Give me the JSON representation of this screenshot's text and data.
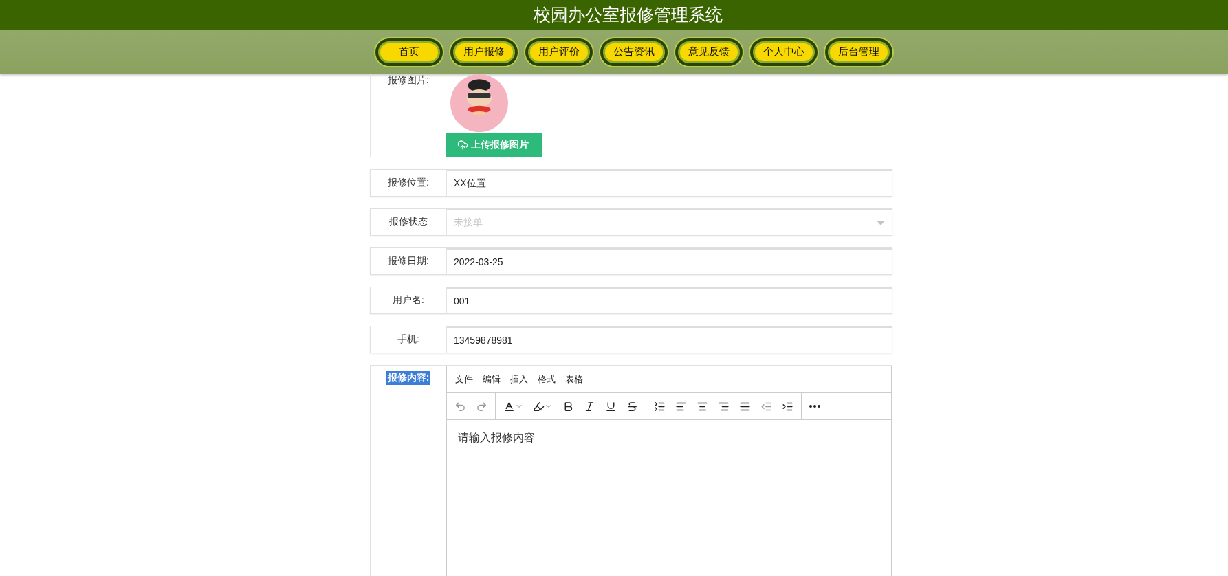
{
  "header": {
    "title": "校园办公室报修管理系统"
  },
  "nav": [
    {
      "label": "首页"
    },
    {
      "label": "用户报修"
    },
    {
      "label": "用户评价"
    },
    {
      "label": "公告资讯"
    },
    {
      "label": "意见反馈"
    },
    {
      "label": "个人中心"
    },
    {
      "label": "后台管理"
    }
  ],
  "image_field": {
    "label": "报修图片:",
    "upload_button": "上传报修图片"
  },
  "fields": [
    {
      "kind": "text",
      "label": "报修位置:",
      "value": "XX位置",
      "disabled": false
    },
    {
      "kind": "select",
      "label": "报修状态",
      "value": "未接单",
      "disabled": true
    },
    {
      "kind": "text",
      "label": "报修日期:",
      "value": "2022-03-25",
      "disabled": false
    },
    {
      "kind": "text",
      "label": "用户名:",
      "value": "001",
      "disabled": false
    },
    {
      "kind": "text",
      "label": "手机:",
      "value": "13459878981",
      "disabled": false
    }
  ],
  "editor": {
    "label": "报修内容:",
    "label_highlighted": true,
    "menu": [
      "文件",
      "编辑",
      "插入",
      "格式",
      "表格"
    ],
    "toolbar": [
      [
        {
          "kind": "undo",
          "disabled": true
        },
        {
          "kind": "redo",
          "disabled": true
        }
      ],
      [
        {
          "kind": "text-color",
          "disabled": false
        },
        {
          "kind": "highlight",
          "disabled": false
        },
        {
          "kind": "bold",
          "disabled": false
        },
        {
          "kind": "italic",
          "disabled": false
        },
        {
          "kind": "underline",
          "disabled": false
        },
        {
          "kind": "strikethrough",
          "disabled": false
        }
      ],
      [
        {
          "kind": "line-height",
          "disabled": false
        },
        {
          "kind": "align-left",
          "disabled": false
        },
        {
          "kind": "align-center",
          "disabled": false
        },
        {
          "kind": "align-right",
          "disabled": false
        },
        {
          "kind": "align-justify",
          "disabled": false
        },
        {
          "kind": "outdent",
          "disabled": true
        },
        {
          "kind": "indent",
          "disabled": false
        }
      ],
      [
        {
          "kind": "more",
          "disabled": false
        }
      ]
    ],
    "placeholder": "请输入报修内容"
  }
}
